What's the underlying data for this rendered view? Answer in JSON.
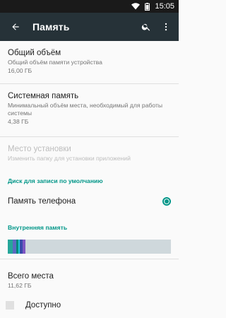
{
  "status_bar": {
    "time": "15:05",
    "icons": [
      "wifi-icon",
      "battery-icon"
    ]
  },
  "toolbar": {
    "title": "Память",
    "back_icon": "arrow-back-icon",
    "search_icon": "search-icon",
    "overflow_icon": "more-vert-icon"
  },
  "prefs": {
    "total": {
      "title": "Общий объём",
      "summary": "Общий объём памяти устройства",
      "value": "16,00 ГБ"
    },
    "system": {
      "title": "Системная память",
      "summary": "Минимальный объём места, необходимый для работы системы",
      "value": "4,38 ГБ"
    },
    "install": {
      "title": "Место установки",
      "summary": "Изменить папку для установки приложений",
      "enabled": false
    }
  },
  "default_disk": {
    "category": "Диск для записи по умолчанию",
    "option": "Память телефона",
    "selected": true
  },
  "internal": {
    "category": "Внутренняя память",
    "usage_segments": [
      {
        "color": "#26a69a",
        "fraction": 0.03
      },
      {
        "color": "#5c6bc0",
        "fraction": 0.02
      },
      {
        "color": "#00897b",
        "fraction": 0.015
      },
      {
        "color": "#26c6da",
        "fraction": 0.01
      },
      {
        "color": "#3949ab",
        "fraction": 0.015
      },
      {
        "color": "#7e57c2",
        "fraction": 0.02
      }
    ],
    "total_label": "Всего места",
    "total_value": "11,62 ГБ",
    "available_label": "Доступно"
  },
  "colors": {
    "accent": "#009688",
    "toolbar": "#263238",
    "statusbar": "#1a1a1a"
  }
}
